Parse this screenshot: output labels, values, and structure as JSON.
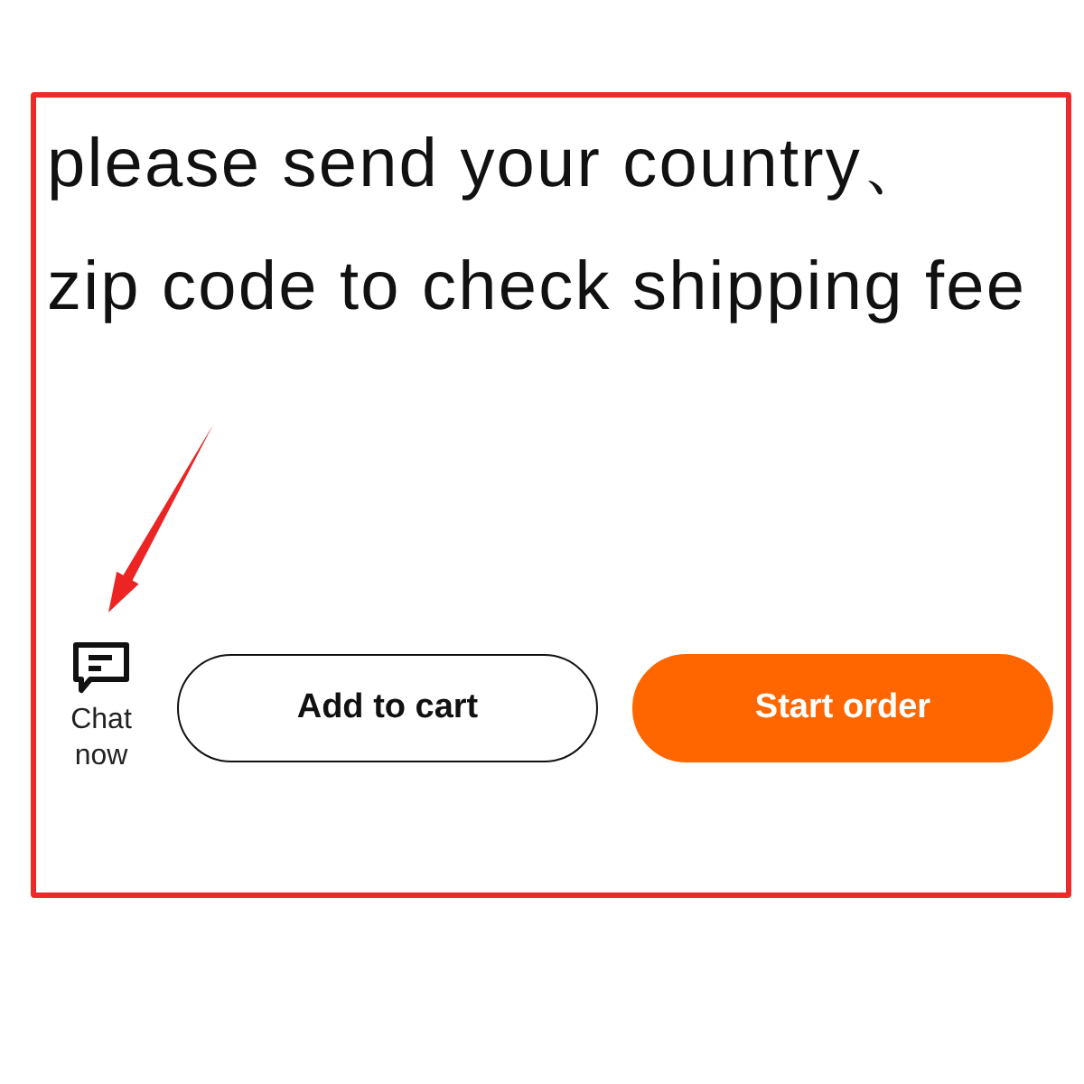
{
  "message": {
    "lines": [
      "please send your country、",
      "zip code to check shipping fee"
    ]
  },
  "chat": {
    "label": "Chat now"
  },
  "buttons": [
    {
      "label": "Add to cart",
      "kind": "outline"
    },
    {
      "label": "Start order",
      "kind": "primary"
    }
  ]
}
